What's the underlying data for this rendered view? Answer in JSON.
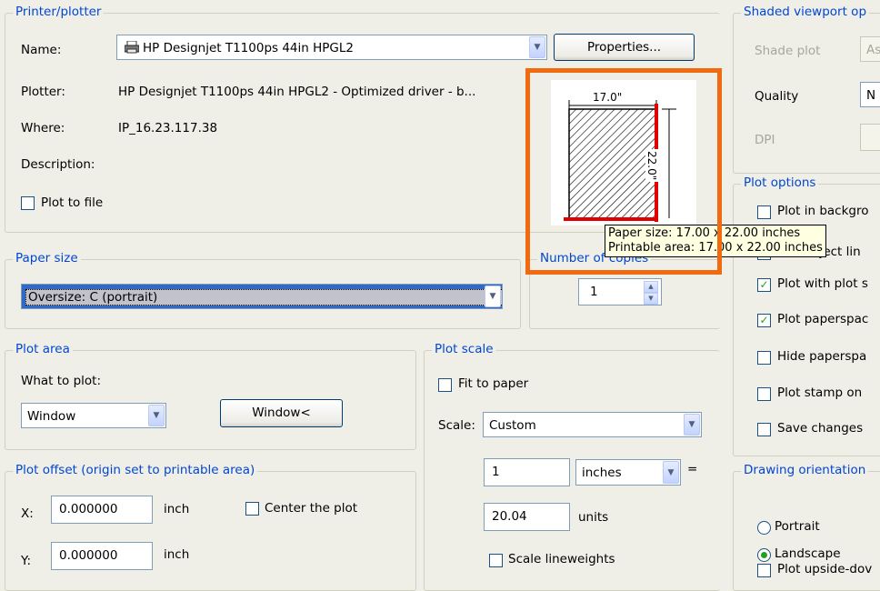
{
  "printer": {
    "group_label": "Printer/plotter",
    "name_label": "Name:",
    "name_value": "HP Designjet T1100ps 44in HPGL2",
    "properties_button": "Properties...",
    "plotter_label": "Plotter:",
    "plotter_value": "HP Designjet T1100ps 44in HPGL2 - Optimized driver - b...",
    "where_label": "Where:",
    "where_value": "IP_16.23.117.38",
    "description_label": "Description:",
    "plot_to_file_label": "Plot to file",
    "plot_to_file_checked": false
  },
  "preview": {
    "width_dim": "17.0\"",
    "height_dim": "22.0\"",
    "tooltip_paper": "Paper size:  17.00 x 22.00 inches",
    "tooltip_printable": "Printable area:  17.00 x 22.00 inches",
    "highlight_color": "#f06a10"
  },
  "paper_size": {
    "group_label": "Paper size",
    "value": "Oversize: C (portrait)"
  },
  "copies": {
    "group_label": "Number of copies",
    "value": "1"
  },
  "plot_area": {
    "group_label": "Plot area",
    "what_label": "What to plot:",
    "what_value": "Window",
    "window_button": "Window<"
  },
  "plot_scale": {
    "group_label": "Plot scale",
    "fit_label": "Fit to paper",
    "fit_checked": false,
    "scale_label": "Scale:",
    "scale_value": "Custom",
    "value1": "1",
    "unit_value": "inches",
    "equals": "=",
    "value2": "20.04",
    "units_label": "units",
    "scale_lineweights_label": "Scale lineweights"
  },
  "plot_offset": {
    "group_label": "Plot offset (origin set to printable area)",
    "x_label": "X:",
    "x_value": "0.000000",
    "x_unit": "inch",
    "y_label": "Y:",
    "y_value": "0.000000",
    "y_unit": "inch",
    "center_label": "Center the plot"
  },
  "shaded": {
    "group_label": "Shaded viewport op",
    "shade_plot_label": "Shade plot",
    "shade_value": "As",
    "quality_label": "Quality",
    "quality_value": "N",
    "dpi_label": "DPI"
  },
  "plot_options": {
    "group_label": "Plot options",
    "items": [
      {
        "label": "Plot in backgro",
        "checked": false
      },
      {
        "label": "Plot object lin",
        "checked": true
      },
      {
        "label": "Plot with plot s",
        "checked": true
      },
      {
        "label": "Plot paperspac",
        "checked": true
      },
      {
        "label": "Hide paperspa",
        "checked": false
      },
      {
        "label": "Plot stamp on",
        "checked": false
      },
      {
        "label": "Save changes",
        "checked": false
      }
    ]
  },
  "orientation": {
    "group_label": "Drawing orientation",
    "portrait": "Portrait",
    "landscape": "Landscape",
    "upside_down": "Plot upside-dov",
    "selected": "landscape"
  }
}
